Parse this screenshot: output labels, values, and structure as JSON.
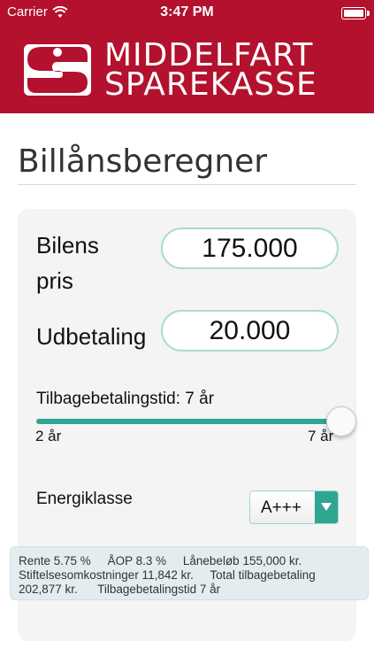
{
  "status_bar": {
    "carrier": "Carrier",
    "time": "3:47 PM"
  },
  "header": {
    "logo_line1": "MIDDELFART",
    "logo_line2": "SPAREKASSE",
    "brand_color": "#b3112e"
  },
  "page": {
    "title": "Billånsberegner"
  },
  "form": {
    "price_label_line1": "Bilens",
    "price_label_line2": "pris",
    "price_value": "175.000",
    "downpayment_label": "Udbetaling",
    "downpayment_value": "20.000",
    "term_label": "Tilbagebetalingstid: 7 år",
    "term_min_label": "2 år",
    "term_max_label": "7 år",
    "term_value_years": 7,
    "term_min_years": 2,
    "term_max_years": 7,
    "energy_label": "Energiklasse",
    "energy_value": "A+++"
  },
  "summary": {
    "rente": "Rente 5.75 %",
    "aop": "ÅOP 8.3 %",
    "laanebeloeb": "Lånebeløb 155,000 kr.",
    "stiftelse": "Stiftelsesomkostninger 11,842 kr.",
    "total_label": "Total tilbagebetaling",
    "total_value": "202,877 kr.",
    "tilbagebetalingstid": "Tilbagebetalingstid 7 år"
  },
  "colors": {
    "accent": "#2fa592",
    "input_border": "#a8dcd2",
    "summary_bg": "#e3edef"
  },
  "icons": {
    "wifi": "wifi-icon",
    "battery": "battery-icon",
    "logo": "sparekasse-s-logo",
    "dropdown": "chevron-down-icon"
  }
}
